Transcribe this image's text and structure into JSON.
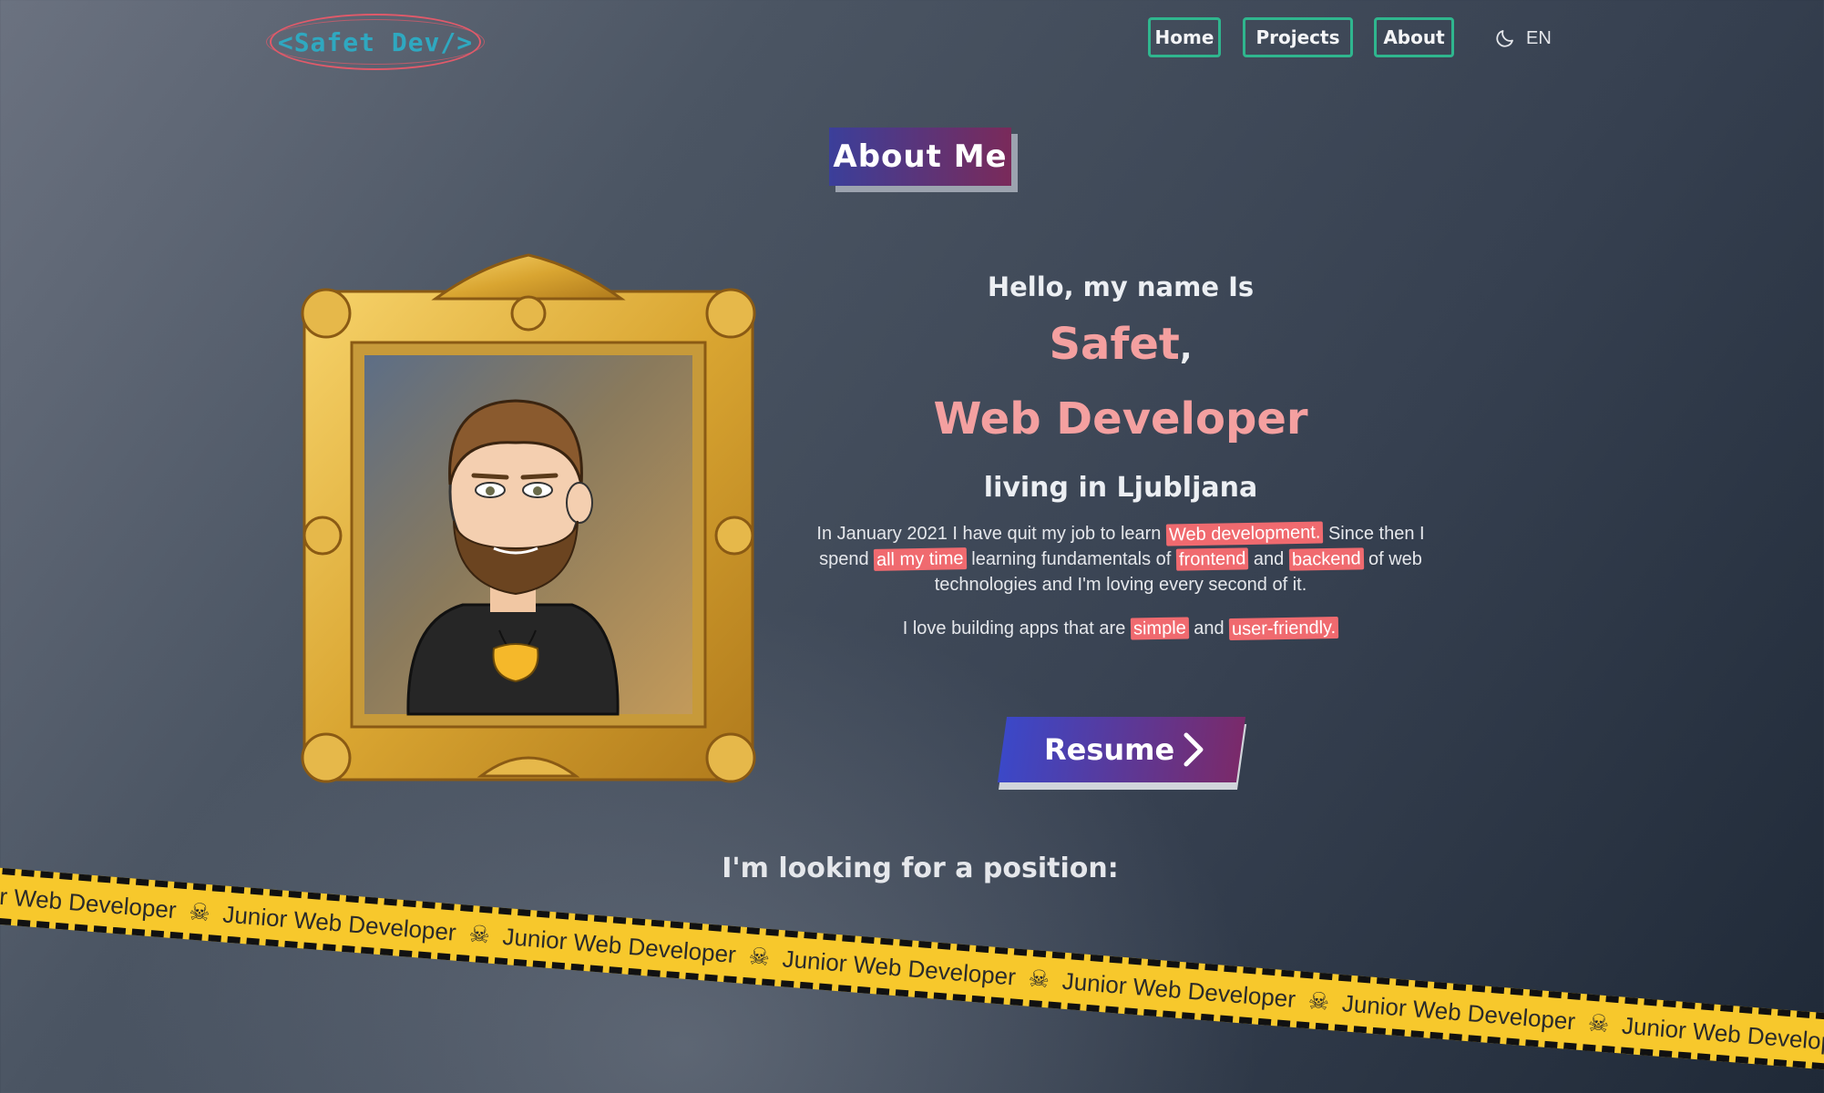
{
  "header": {
    "logo": "<Safet Dev/>",
    "nav": [
      {
        "label": "Home"
      },
      {
        "label": "Projects"
      },
      {
        "label": "About"
      }
    ],
    "theme_icon": "moon-icon",
    "language": "EN"
  },
  "about": {
    "title": "About Me",
    "greeting": "Hello, my name Is",
    "name": "Safet",
    "name_comma": ",",
    "role": "Web Developer",
    "city": "living in Ljubljana",
    "paragraph1": {
      "t1": "In January 2021 I have quit my job to learn ",
      "h1": "Web development.",
      "t2": " Since then I spend ",
      "h2": "all my time",
      "t3": " learning fundamentals of ",
      "h3": "frontend",
      "t4": " and ",
      "h4": "backend",
      "t5": " of web technologies and I'm loving every second of it."
    },
    "paragraph2": {
      "t1": "I love building apps that are ",
      "h1": "simple",
      "t2": " and ",
      "h2": "user-friendly."
    },
    "resume_label": "Resume",
    "looking": "I'm looking for a position:",
    "tape_text": "Junior Web Developer",
    "tape_icon": "skull-crossbones-icon"
  },
  "colors": {
    "accent_green": "#2fb68e",
    "accent_pink": "#f4a0a0",
    "highlight": "#f06a6f",
    "tape_yellow": "#f7c82c"
  }
}
